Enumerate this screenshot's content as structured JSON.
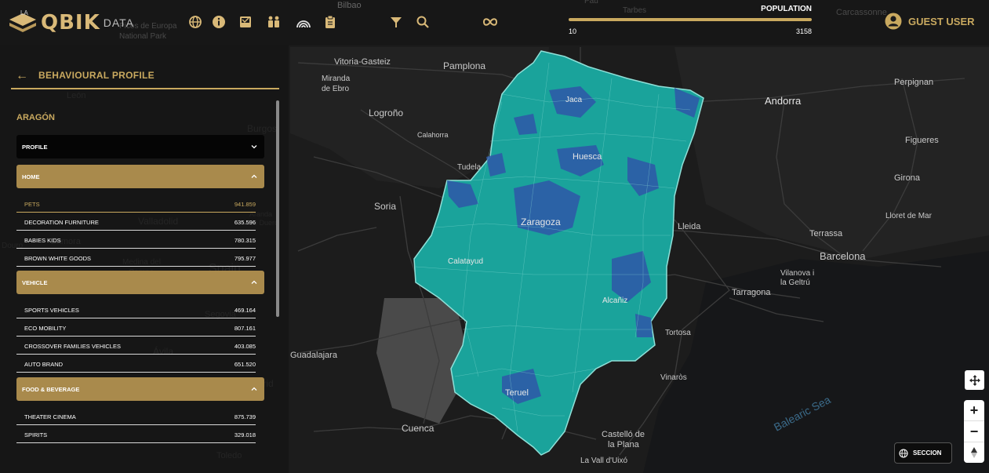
{
  "app": {
    "logo_prefix": "LA",
    "logo_text": "QBIK",
    "logo_sub": "DATA"
  },
  "toolbar": {
    "icons": [
      "globe-icon",
      "info-icon",
      "inbox-icon",
      "people-icon",
      "rainbow-icon",
      "clipboard-icon",
      "filter-icon",
      "search-icon",
      "infinity-icon"
    ]
  },
  "population": {
    "title": "POPULATION",
    "min": "10",
    "max": "3158"
  },
  "user": {
    "label": "GUEST USER"
  },
  "panel": {
    "title": "BEHAVIOURAL PROFILE",
    "region": "ARAGÓN",
    "sections": [
      {
        "label": "PROFILE",
        "expanded": false,
        "items": []
      },
      {
        "label": "HOME",
        "expanded": true,
        "items": [
          {
            "label": "PETS",
            "value": "941.859",
            "active": true
          },
          {
            "label": "DECORATION FURNITURE",
            "value": "635.596"
          },
          {
            "label": "BABIES KIDS",
            "value": "780.315"
          },
          {
            "label": "BROWN WHITE GOODS",
            "value": "795.977"
          }
        ]
      },
      {
        "label": "VEHICLE",
        "expanded": true,
        "items": [
          {
            "label": "SPORTS VEHICLES",
            "value": "469.164"
          },
          {
            "label": "ECO MOBILITY",
            "value": "807.161"
          },
          {
            "label": "CROSSOVER FAMILIES VEHICLES",
            "value": "403.085"
          },
          {
            "label": "AUTO BRAND",
            "value": "651.520"
          }
        ]
      },
      {
        "label": "FOOD & BEVERAGE",
        "expanded": true,
        "items": [
          {
            "label": "THEATER CINEMA",
            "value": "875.739"
          },
          {
            "label": "SPIRITS",
            "value": "329.018"
          }
        ]
      }
    ]
  },
  "map": {
    "place_labels": [
      "Bilbao",
      "Pau",
      "Tarbes",
      "Carcassonne",
      "Picos de Europa National Park",
      "Vitoria-Gasteiz",
      "Pamplona",
      "Miranda de Ebro",
      "Logroño",
      "Calahorra",
      "Tudela",
      "Soria",
      "Jaca",
      "Huesca",
      "Zaragoza",
      "Calatayud",
      "Alcañiz",
      "Teruel",
      "Andorra",
      "Perpignan",
      "Figueres",
      "Girona",
      "Lloret de Mar",
      "Lleida",
      "Terrassa",
      "Barcelona",
      "Vilanova i la Geltrú",
      "Tarragona",
      "Tortosa",
      "Vinaròs",
      "Guadalajara",
      "Cuenca",
      "Castelló de la Plana",
      "La Vall d'Uixó",
      "Balearic Sea",
      "León",
      "Burgos",
      "Palencia",
      "Valladolid",
      "Aranda de Duero",
      "Zamora",
      "Medina del Campo",
      "Spain",
      "Segovia",
      "Ávila",
      "Madrid",
      "Toledo"
    ],
    "colors": {
      "region_fill": "#1aa39b",
      "region_dark": "#2f57a8",
      "region_border": "#8fe0d8",
      "basemap": "#1b1b1b",
      "road": "#3a3a3a",
      "accent": "#c9a95f"
    }
  },
  "controls": {
    "seccion_label": "SECCION"
  }
}
